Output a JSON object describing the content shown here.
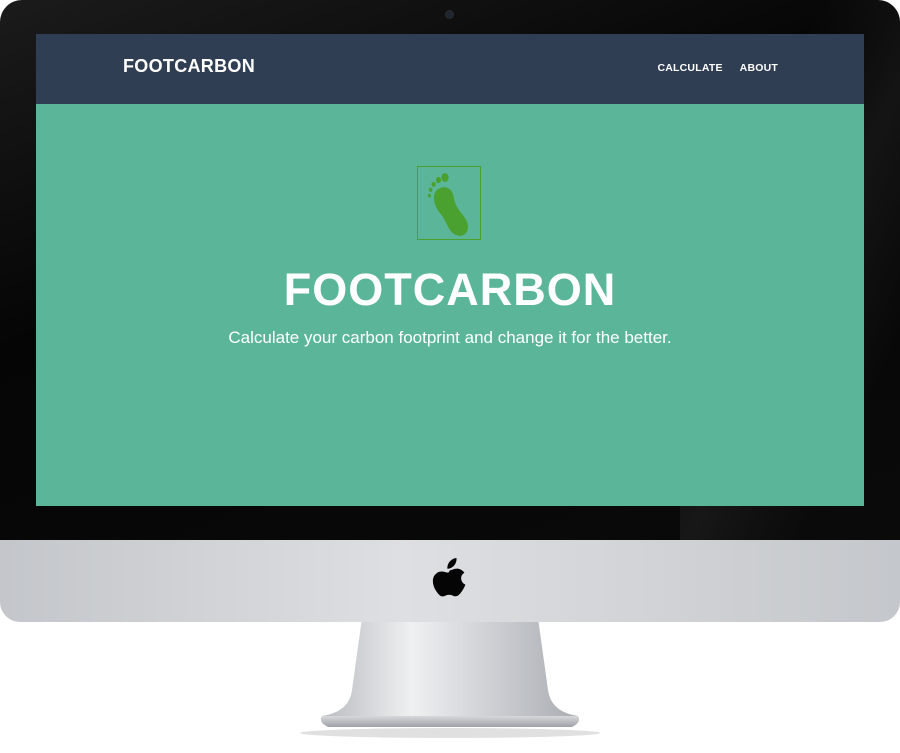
{
  "navbar": {
    "brand": "FOOTCARBON",
    "links": [
      {
        "label": "CALCULATE"
      },
      {
        "label": "ABOUT"
      }
    ]
  },
  "hero": {
    "logo_icon": "footprint-icon",
    "title": "FOOTCARBON",
    "subtitle": "Calculate your carbon footprint and change it for the better."
  },
  "colors": {
    "navbar_bg": "#2f3e52",
    "hero_bg": "#5bb699",
    "logo_green": "#4aa12f"
  },
  "device": {
    "logo_icon": "apple-logo-icon"
  }
}
